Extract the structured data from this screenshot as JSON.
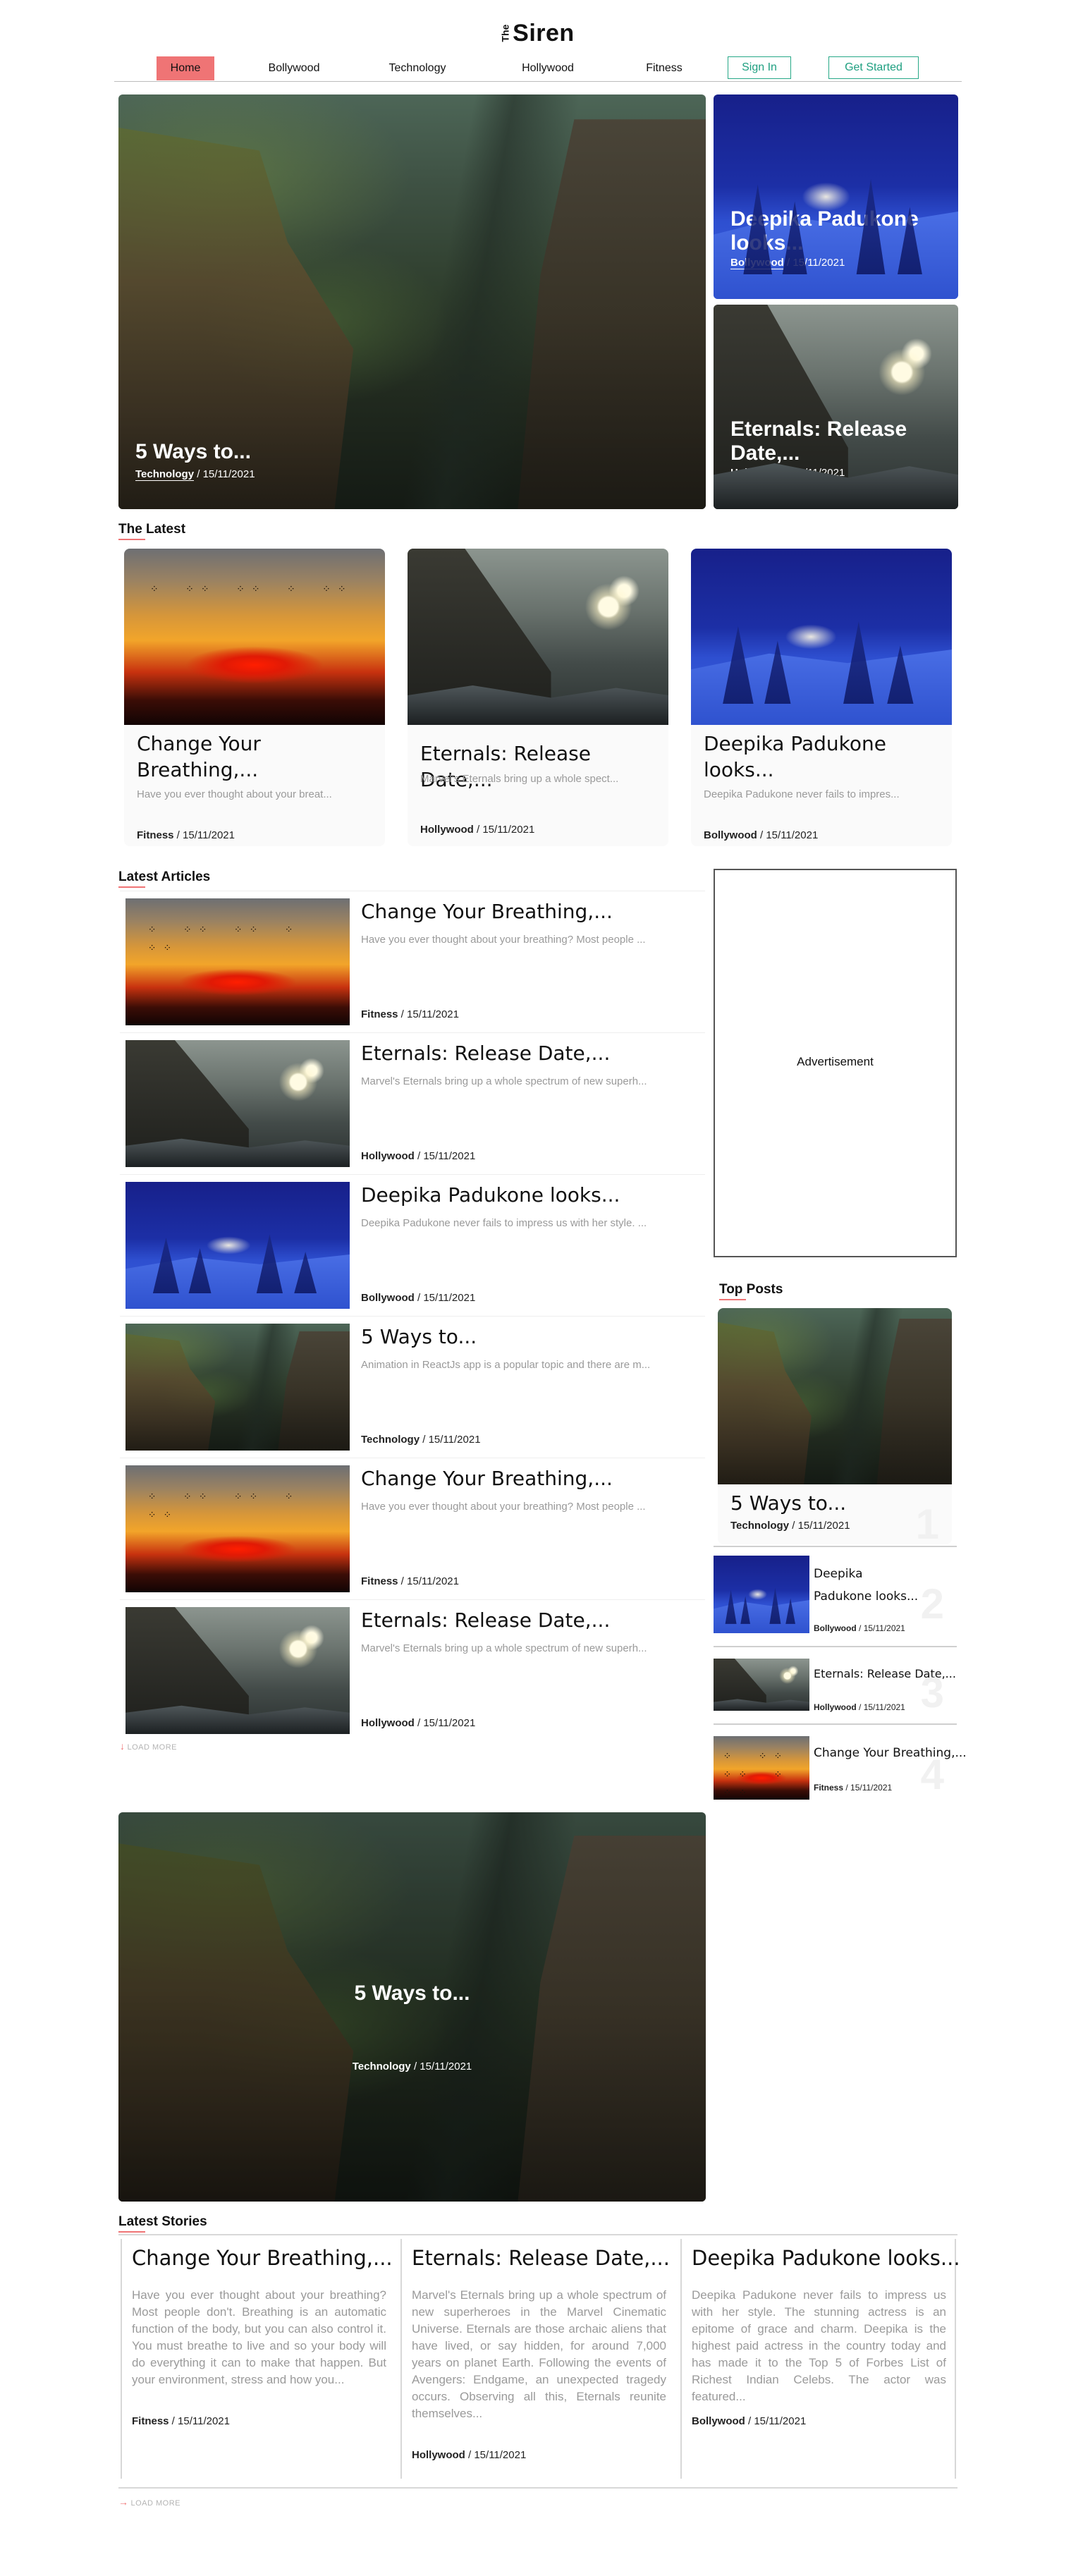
{
  "header": {
    "logo_small": "The",
    "logo_main": "Siren",
    "nav": [
      "Home",
      "Bollywood",
      "Technology",
      "Hollywood",
      "Fitness"
    ],
    "sign_in": "Sign In",
    "get_started": "Get Started"
  },
  "hero": {
    "main": {
      "title": "5 Ways to...",
      "category": "Technology",
      "date": "15/11/2021"
    },
    "side": [
      {
        "title": "Deepika Padukone looks...",
        "category": "Bollywood",
        "date": "15/11/2021"
      },
      {
        "title": "Eternals: Release Date,...",
        "category": "Hollywood",
        "date": "15/11/2021"
      }
    ]
  },
  "latest": {
    "heading": "The Latest",
    "cards": [
      {
        "title": "Change Your Breathing,...",
        "excerpt": "Have you ever thought about your breat...",
        "category": "Fitness",
        "date": "15/11/2021"
      },
      {
        "title": "Eternals: Release Date,...",
        "excerpt": "Marvel's Eternals bring up a whole spect...",
        "category": "Hollywood",
        "date": "15/11/2021"
      },
      {
        "title": "Deepika Padukone looks...",
        "excerpt": "Deepika Padukone never fails to impres...",
        "category": "Bollywood",
        "date": "15/11/2021"
      }
    ]
  },
  "articles": {
    "heading": "Latest Articles",
    "items": [
      {
        "title": "Change Your Breathing,...",
        "excerpt": "Have you ever thought about your breathing? Most people ...",
        "category": "Fitness",
        "date": "15/11/2021"
      },
      {
        "title": "Eternals: Release Date,...",
        "excerpt": "Marvel's Eternals bring up a whole spectrum of new superh...",
        "category": "Hollywood",
        "date": "15/11/2021"
      },
      {
        "title": "Deepika Padukone looks...",
        "excerpt": "Deepika Padukone never fails to impress us with her style. ...",
        "category": "Bollywood",
        "date": "15/11/2021"
      },
      {
        "title": "5 Ways to...",
        "excerpt": "Animation in ReactJs app is a popular topic and there are m...",
        "category": "Technology",
        "date": "15/11/2021"
      },
      {
        "title": "Change Your Breathing,...",
        "excerpt": "Have you ever thought about your breathing? Most people ...",
        "category": "Fitness",
        "date": "15/11/2021"
      },
      {
        "title": "Eternals: Release Date,...",
        "excerpt": "Marvel's Eternals bring up a whole spectrum of new superh...",
        "category": "Hollywood",
        "date": "15/11/2021"
      }
    ],
    "load_more": "LOAD MORE"
  },
  "sidebar": {
    "advertisement": "Advertisement",
    "top_posts_heading": "Top Posts",
    "top_posts": [
      {
        "rank": "1",
        "title": "5 Ways to...",
        "category": "Technology",
        "date": "15/11/2021"
      },
      {
        "rank": "2",
        "title": "Deepika Padukone looks...",
        "category": "Bollywood",
        "date": "15/11/2021"
      },
      {
        "rank": "3",
        "title": "Eternals: Release Date,...",
        "category": "Hollywood",
        "date": "15/11/2021"
      },
      {
        "rank": "4",
        "title": "Change Your Breathing,...",
        "category": "Fitness",
        "date": "15/11/2021"
      }
    ]
  },
  "banner": {
    "title": "5 Ways to...",
    "category": "Technology",
    "date": "15/11/2021"
  },
  "stories": {
    "heading": "Latest Stories",
    "items": [
      {
        "title": "Change Your Breathing,...",
        "body": "Have you ever thought about your breathing? Most people don't. Breathing is an automatic function of the body, but you can also control it. You must breathe to live and so your body will do everything it can to make that happen. But your environment, stress and how you...",
        "category": "Fitness",
        "date": "15/11/2021"
      },
      {
        "title": "Eternals: Release Date,...",
        "body": "Marvel's Eternals bring up a whole spectrum of new superheroes in the Marvel Cinematic Universe. Eternals are those archaic aliens that have lived, or say hidden, for around 7,000 years on planet Earth. Following the events of Avengers: Endgame, an unexpected tragedy occurs. Observing all this, Eternals reunite themselves...",
        "category": "Hollywood",
        "date": "15/11/2021"
      },
      {
        "title": "Deepika Padukone looks...",
        "body": "Deepika Padukone never fails to impress us with her style. The stunning actress is an epitome of grace and charm. Deepika is the highest paid actress in the country today and has made it to the Top 5 of Forbes List of Richest Indian Celebs. The actor was featured...",
        "category": "Bollywood",
        "date": "15/11/2021"
      }
    ],
    "load_more": "LOAD MORE"
  },
  "colors": {
    "accent": "#ef7475",
    "button": "#26a887",
    "muted": "#9a9a9a"
  }
}
